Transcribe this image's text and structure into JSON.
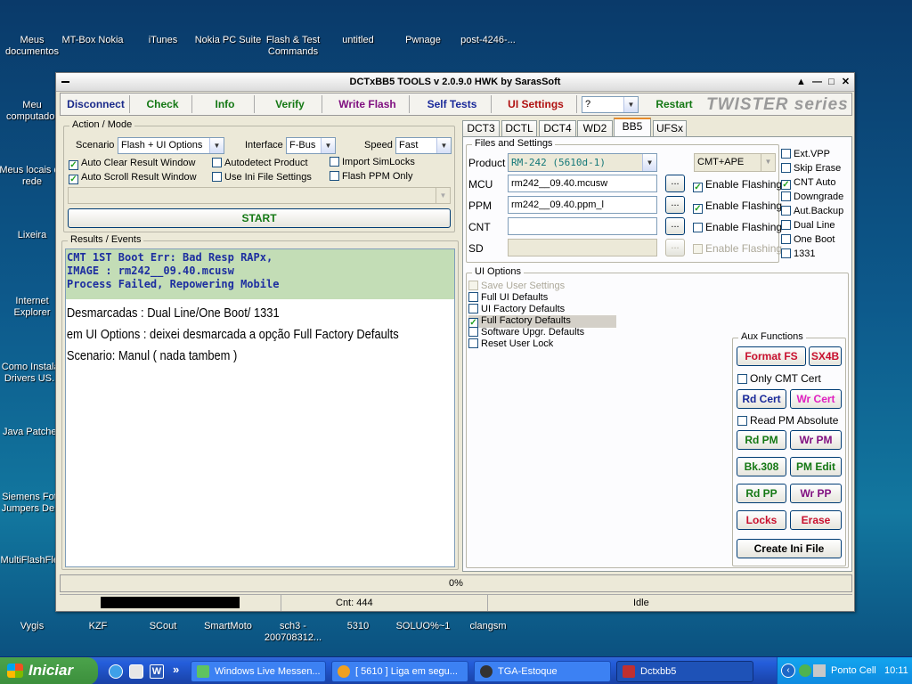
{
  "desktop": {
    "icons": [
      {
        "label": "Meus documentos",
        "color": "#f5d36b"
      },
      {
        "label": "MT-Box Nokia",
        "color": "#d42020"
      },
      {
        "label": "iTunes",
        "color": "#6fb7e8"
      },
      {
        "label": "Nokia PC Suite",
        "color": "#9fb3c4"
      },
      {
        "label": "Flash & Test Commands",
        "color": "#2a3fb0"
      },
      {
        "label": "untitled",
        "color": "#e8d88a"
      },
      {
        "label": "Pwnage",
        "color": "#f2cf5b"
      },
      {
        "label": "post-4246-...",
        "color": "#d9532b"
      },
      {
        "label": "Meu computador",
        "color": "#b7c9dd"
      },
      {
        "label": "Meus locais de rede",
        "color": "#4a9de0"
      },
      {
        "label": "Lixeira",
        "color": "#5fb85f"
      },
      {
        "label": "Internet Explorer",
        "color": "#2f79d4"
      },
      {
        "label": "Como Instalar Drivers US...",
        "color": "#f2cf5b"
      },
      {
        "label": "Java Patches",
        "color": "#f2cf5b"
      },
      {
        "label": "Siemens Foto Jumpers De...",
        "color": "#f2cf5b"
      },
      {
        "label": "MultiFlashFlex",
        "color": "#222222"
      },
      {
        "label": "Vygis",
        "color": "#c8304a"
      },
      {
        "label": "KZF",
        "color": "#e0e0e0"
      },
      {
        "label": "SCout",
        "color": "#6a9a3a"
      },
      {
        "label": "SmartMoto",
        "color": "#c0c0c0"
      },
      {
        "label": "sch3 - 200708312...",
        "color": "#c0c0c0"
      },
      {
        "label": "5310",
        "color": "#c0c0c0"
      },
      {
        "label": "SOLUO%~1",
        "color": "#c0c0c0"
      },
      {
        "label": "clangsm",
        "color": "#c0c0c0"
      }
    ]
  },
  "window": {
    "title": "DCTxBB5 TOOLS v 2.0.9.0 HWK by SarasSoft",
    "controls": {
      "up": "▲",
      "minimize": "—",
      "maximize": "□",
      "close": "✕"
    }
  },
  "toolbar": {
    "disconnect": "Disconnect",
    "check": "Check",
    "info": "Info",
    "verify": "Verify",
    "write_flash": "Write Flash",
    "self_tests": "Self Tests",
    "ui_settings": "UI Settings",
    "select": "?",
    "restart": "Restart",
    "brand": "TWISTER series"
  },
  "action_mode": {
    "legend": "Action / Mode",
    "scenario_label": "Scenario",
    "scenario_value": "Flash + UI Options",
    "interface_label": "Interface",
    "interface_value": "F-Bus",
    "speed_label": "Speed",
    "speed_value": "Fast",
    "checks": [
      {
        "label": "Auto Clear Result Window",
        "checked": true
      },
      {
        "label": "Autodetect Product",
        "checked": false
      },
      {
        "label": "Import SimLocks",
        "checked": false
      },
      {
        "label": "Auto Scroll Result Window",
        "checked": true
      },
      {
        "label": "Use Ini File Settings",
        "checked": false
      },
      {
        "label": "Flash PPM Only",
        "checked": false
      }
    ],
    "start": "START"
  },
  "results": {
    "legend": "Results / Events",
    "log": [
      "CMT 1ST Boot Err: Bad Resp RAPx,",
      "IMAGE : rm242__09.40.mcusw",
      "Process Failed, Repowering Mobile"
    ],
    "notes": [
      "Desmarcadas : Dual Line/One Boot/ 1331",
      "em UI Options : deixei desmarcada a opção Full Factory Defaults",
      "Scenario: Manul ( nada tambem )"
    ]
  },
  "tabs": [
    "DCT3",
    "DCTL",
    "DCT4",
    "WD2",
    "BB5",
    "UFSx"
  ],
  "active_tab": "BB5",
  "files": {
    "legend": "Files and Settings",
    "product_label": "Product",
    "product_value": "RM-242  (5610d-1)",
    "mode_value": "CMT+APE",
    "mcu_label": "MCU",
    "mcu_value": "rm242__09.40.mcusw",
    "ppm_label": "PPM",
    "ppm_value": "rm242__09.40.ppm_l",
    "cnt_label": "CNT",
    "cnt_value": "",
    "sd_label": "SD",
    "sd_value": "",
    "browse": "...",
    "enable_flashing": "Enable Flashing",
    "enable_states": [
      true,
      true,
      false,
      false
    ],
    "right_checks": [
      {
        "label": "Ext.VPP",
        "checked": false
      },
      {
        "label": "Skip Erase",
        "checked": false
      },
      {
        "label": "CNT Auto",
        "checked": true
      },
      {
        "label": "Downgrade",
        "checked": false
      },
      {
        "label": "Aut.Backup",
        "checked": false
      },
      {
        "label": "Dual Line",
        "checked": false
      },
      {
        "label": "One Boot",
        "checked": false
      },
      {
        "label": "1331",
        "checked": false
      }
    ]
  },
  "ui_options": {
    "legend": "UI Options",
    "items": [
      {
        "label": "Save User Settings",
        "checked": false,
        "disabled": true
      },
      {
        "label": "Full UI Defaults",
        "checked": false,
        "disabled": false
      },
      {
        "label": "UI Factory Defaults",
        "checked": false,
        "disabled": false
      },
      {
        "label": "Full Factory Defaults",
        "checked": true,
        "disabled": false
      },
      {
        "label": "Software Upgr. Defaults",
        "checked": false,
        "disabled": false
      },
      {
        "label": "Reset User Lock",
        "checked": false,
        "disabled": false
      }
    ]
  },
  "aux": {
    "legend": "Aux Functions",
    "format_fs": "Format FS",
    "sx4b": "SX4B",
    "only_cmt_cert": "Only CMT Cert",
    "rd_cert": "Rd Cert",
    "wr_cert": "Wr Cert",
    "read_pm_absolute": "Read PM Absolute",
    "rd_pm": "Rd PM",
    "wr_pm": "Wr PM",
    "bk308": "Bk.308",
    "pm_edit": "PM Edit",
    "rd_pp": "Rd PP",
    "wr_pp": "Wr PP",
    "locks": "Locks",
    "erase": "Erase",
    "create_ini": "Create Ini File"
  },
  "progress": {
    "percent": "0%",
    "value": 0
  },
  "status": {
    "cnt": "Cnt: 444",
    "state": "Idle"
  },
  "taskbar": {
    "start": "Iniciar",
    "more": "»",
    "tasks": [
      "Windows Live Messen...",
      "[ 5610 ] Liga em segu...",
      "TGA-Estoque",
      "Dctxbb5"
    ],
    "clock": "10:11",
    "tray_text": "Ponto Cell"
  }
}
